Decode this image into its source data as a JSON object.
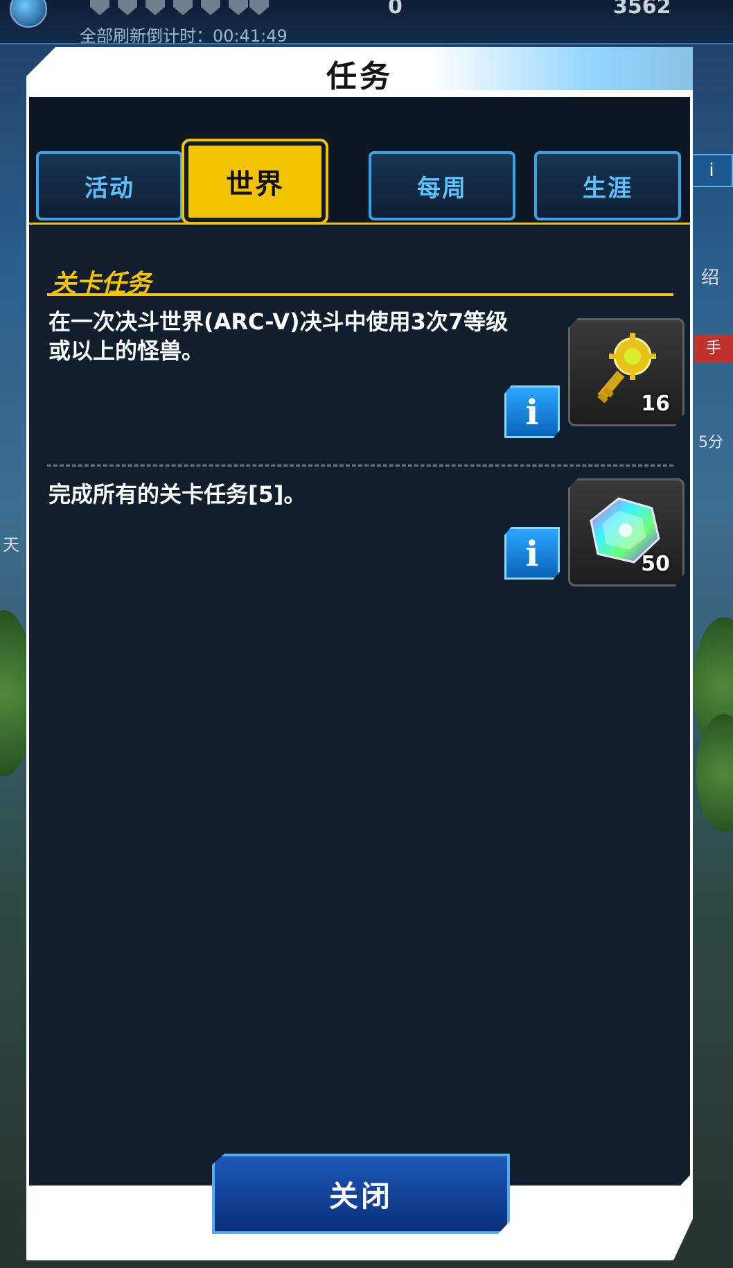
{
  "background": {
    "refresh_countdown": "全部刷新倒计时：00:41:49",
    "resource_a": "0",
    "resource_b": "3562",
    "side_labels": [
      "绍",
      "手",
      "5分",
      "天"
    ]
  },
  "dialog": {
    "title": "任务",
    "tabs": [
      {
        "label": "活动",
        "active": false
      },
      {
        "label": "世界",
        "active": true
      },
      {
        "label": "每周",
        "active": false
      },
      {
        "label": "生涯",
        "active": false
      }
    ],
    "section_title": "关卡任务",
    "missions": [
      {
        "description": "在一次决斗世界(ARC-V)决斗中使用3次7等级或以上的怪兽。",
        "info_label": "i",
        "reward_icon": "gold-key-icon",
        "reward_count": "16"
      },
      {
        "description": "完成所有的关卡任务[5]。",
        "info_label": "i",
        "reward_icon": "rainbow-gem-icon",
        "reward_count": "50"
      }
    ],
    "close_label": "关闭"
  },
  "colors": {
    "accent": "#f5c400",
    "tab_blue": "#3aa3e6",
    "panel": "#101e2e"
  }
}
